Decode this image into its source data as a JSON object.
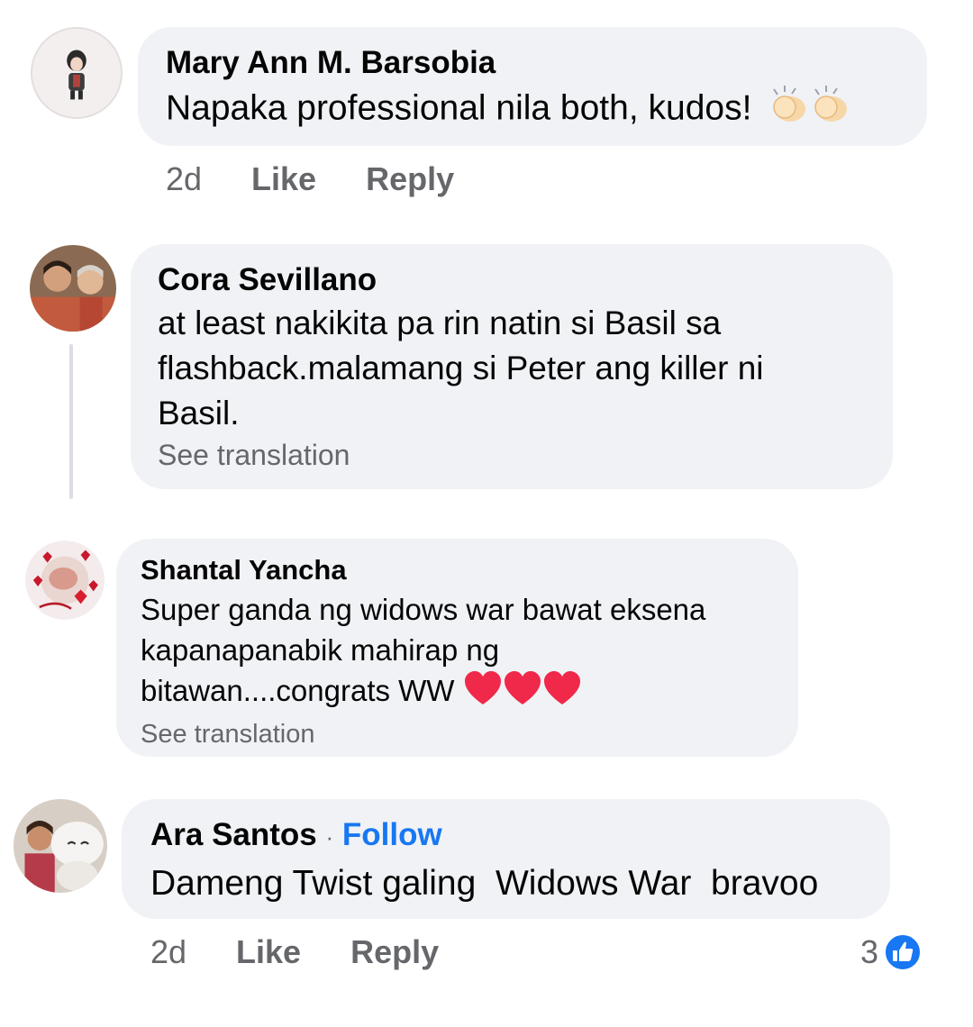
{
  "comments": [
    {
      "author": "Mary Ann M. Barsobia",
      "text": "Napaka professional nila both, kudos!",
      "emoji": [
        "clapping-hands",
        "clapping-hands"
      ],
      "time": "2d",
      "like_label": "Like",
      "reply_label": "Reply"
    },
    {
      "author": "Cora Sevillano",
      "lines": [
        "at least nakikita pa rin natin si Basil sa",
        "flashback.malamang si Peter ang killer ni",
        "Basil."
      ],
      "see_translation": "See translation"
    },
    {
      "author": "Shantal Yancha",
      "lines": [
        "Super ganda ng widows war bawat eksena",
        "kapanapanabik mahirap ng",
        "bitawan....congrats WW"
      ],
      "emoji": [
        "red-heart",
        "red-heart",
        "red-heart"
      ],
      "see_translation": "See translation"
    },
    {
      "author": "Ara Santos",
      "separator": "·",
      "follow_label": "Follow",
      "text": "Dameng Twist galing  Widows War  bravoo",
      "time": "2d",
      "like_label": "Like",
      "reply_label": "Reply",
      "reaction_count": "3",
      "reaction_icon": "like-thumb-icon"
    }
  ],
  "colors": {
    "bubble": "#f0f2f5",
    "secondary_text": "#65676b",
    "link": "#1877f2",
    "heart": "#f02849"
  }
}
